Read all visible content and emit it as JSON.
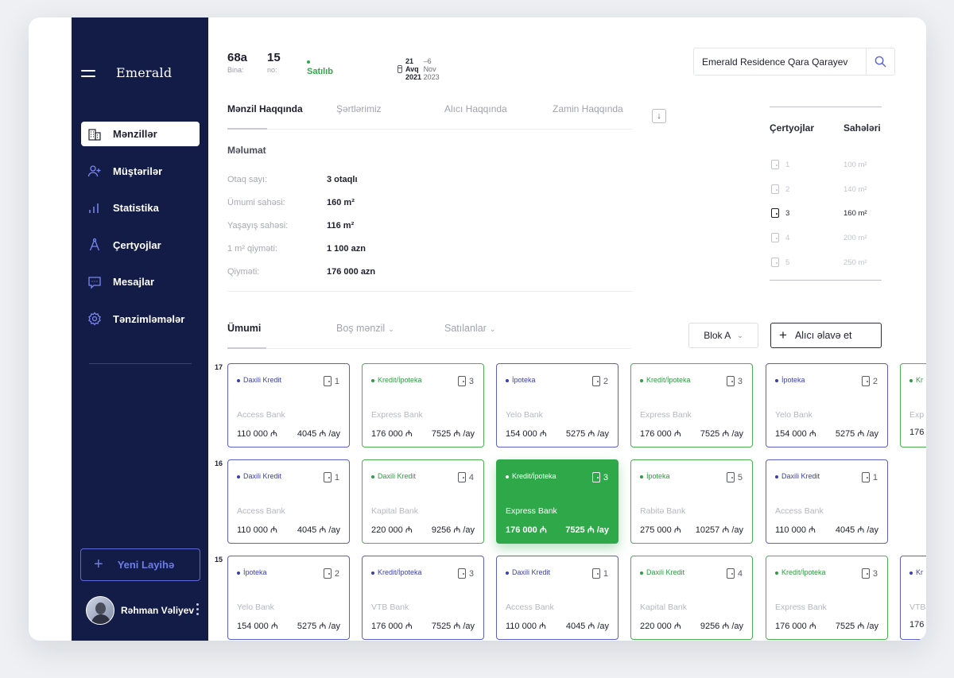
{
  "sidebar": {
    "brand": "Emerald",
    "items": [
      {
        "label": "Mənzillər",
        "icon": "building-icon"
      },
      {
        "label": "Müştərilər",
        "icon": "add-user-icon"
      },
      {
        "label": "Statistika",
        "icon": "bar-chart-icon"
      },
      {
        "label": "Çertyojlar",
        "icon": "compass-icon"
      },
      {
        "label": "Mesajlar",
        "icon": "message-icon"
      },
      {
        "label": "Tənzimləmələr",
        "icon": "gear-icon"
      }
    ],
    "new_project": "Yeni Layihə",
    "user_name": "Rəhman Vəliyev"
  },
  "header": {
    "bina_value": "68a",
    "bina_label": "Bina:",
    "no_value": "15",
    "no_label": "no:",
    "status": "Satılıb",
    "date_start": "21 Avq 2021",
    "date_end": "–6 Nov 2023",
    "search_value": "Emerald Residence Qara Qarayev"
  },
  "tabs": [
    "Mənzil Haqqında",
    "Şərtlərimiz",
    "Alıcı Haqqında",
    "Zamin Haqqında"
  ],
  "info": {
    "title": "Məlumat",
    "rows": [
      {
        "k": "Otaq sayı:",
        "v": "3 otaqlı"
      },
      {
        "k": "Ümumi sahəsi:",
        "v": "160 m²"
      },
      {
        "k": "Yaşayış sahəsi:",
        "v": "116 m²"
      },
      {
        "k": "1 m² qiyməti:",
        "v": "1 100 azn"
      },
      {
        "k": "Qiyməti:",
        "v": "176 000 azn"
      }
    ]
  },
  "plans": {
    "h1": "Çertyojlar",
    "h2": "Sahələri",
    "rows": [
      {
        "num": "1",
        "area": "100 m²"
      },
      {
        "num": "2",
        "area": "140 m²"
      },
      {
        "num": "3",
        "area": "160 m²"
      },
      {
        "num": "4",
        "area": "200 m²"
      },
      {
        "num": "5",
        "area": "250 m²"
      }
    ]
  },
  "filters": {
    "tabs": [
      "Ümumi",
      "Boş mənzil",
      "Satılanlar"
    ],
    "blok": "Blok A",
    "add_buyer": "Alıcı əlavə et"
  },
  "floors": [
    {
      "label": "17",
      "cards": [
        {
          "type": "Daxili Kredit",
          "rooms": "1",
          "bank": "Access Bank",
          "price": "110 000 ₼",
          "monthly": "4045 ₼ /ay",
          "color": "purple"
        },
        {
          "type": "Kredit/İpoteka",
          "rooms": "3",
          "bank": "Express Bank",
          "price": "176 000 ₼",
          "monthly": "7525 ₼ /ay",
          "color": "green"
        },
        {
          "type": "İpoteka",
          "rooms": "2",
          "bank": "Yelo Bank",
          "price": "154 000 ₼",
          "monthly": "5275 ₼ /ay",
          "color": "purple"
        },
        {
          "type": "Kredit/İpoteka",
          "rooms": "3",
          "bank": "Express Bank",
          "price": "176 000 ₼",
          "monthly": "7525 ₼ /ay",
          "color": "green"
        },
        {
          "type": "İpoteka",
          "rooms": "2",
          "bank": "Yelo Bank",
          "price": "154 000 ₼",
          "monthly": "5275 ₼ /ay",
          "color": "purple"
        },
        {
          "type": "Kr",
          "rooms": "",
          "bank": "Exp",
          "price": "176",
          "monthly": "",
          "color": "green"
        }
      ]
    },
    {
      "label": "16",
      "cards": [
        {
          "type": "Daxili Kredit",
          "rooms": "1",
          "bank": "Access Bank",
          "price": "110 000 ₼",
          "monthly": "4045 ₼ /ay",
          "color": "purple"
        },
        {
          "type": "Daxili Kredit",
          "rooms": "4",
          "bank": "Kapital Bank",
          "price": "220 000 ₼",
          "monthly": "9256 ₼ /ay",
          "color": "green"
        },
        {
          "type": "Kredit/İpoteka",
          "rooms": "3",
          "bank": "Express Bank",
          "price": "176 000 ₼",
          "monthly": "7525 ₼ /ay",
          "color": "selected"
        },
        {
          "type": "İpoteka",
          "rooms": "5",
          "bank": "Rabitə Bank",
          "price": "275 000 ₼",
          "monthly": "10257 ₼ /ay",
          "color": "green"
        },
        {
          "type": "Daxili Kredit",
          "rooms": "1",
          "bank": "Access Bank",
          "price": "110 000 ₼",
          "monthly": "4045 ₼ /ay",
          "color": "purple"
        }
      ]
    },
    {
      "label": "15",
      "cards": [
        {
          "type": "İpoteka",
          "rooms": "2",
          "bank": "Yelo Bank",
          "price": "154 000 ₼",
          "monthly": "5275 ₼ /ay",
          "color": "purple"
        },
        {
          "type": "Kredit/İpoteka",
          "rooms": "3",
          "bank": "VTB Bank",
          "price": "176 000 ₼",
          "monthly": "7525 ₼ /ay",
          "color": "purple"
        },
        {
          "type": "Daxili Kredit",
          "rooms": "1",
          "bank": "Access Bank",
          "price": "110 000 ₼",
          "monthly": "4045 ₼ /ay",
          "color": "purple"
        },
        {
          "type": "Daxili Kredit",
          "rooms": "4",
          "bank": "Kapital Bank",
          "price": "220 000 ₼",
          "monthly": "9256 ₼ /ay",
          "color": "green"
        },
        {
          "type": "Kredit/İpoteka",
          "rooms": "3",
          "bank": "Express Bank",
          "price": "176 000 ₼",
          "monthly": "7525 ₼ /ay",
          "color": "green"
        },
        {
          "type": "Kr",
          "rooms": "",
          "bank": "VTB",
          "price": "176",
          "monthly": "",
          "color": "purple"
        }
      ]
    }
  ]
}
